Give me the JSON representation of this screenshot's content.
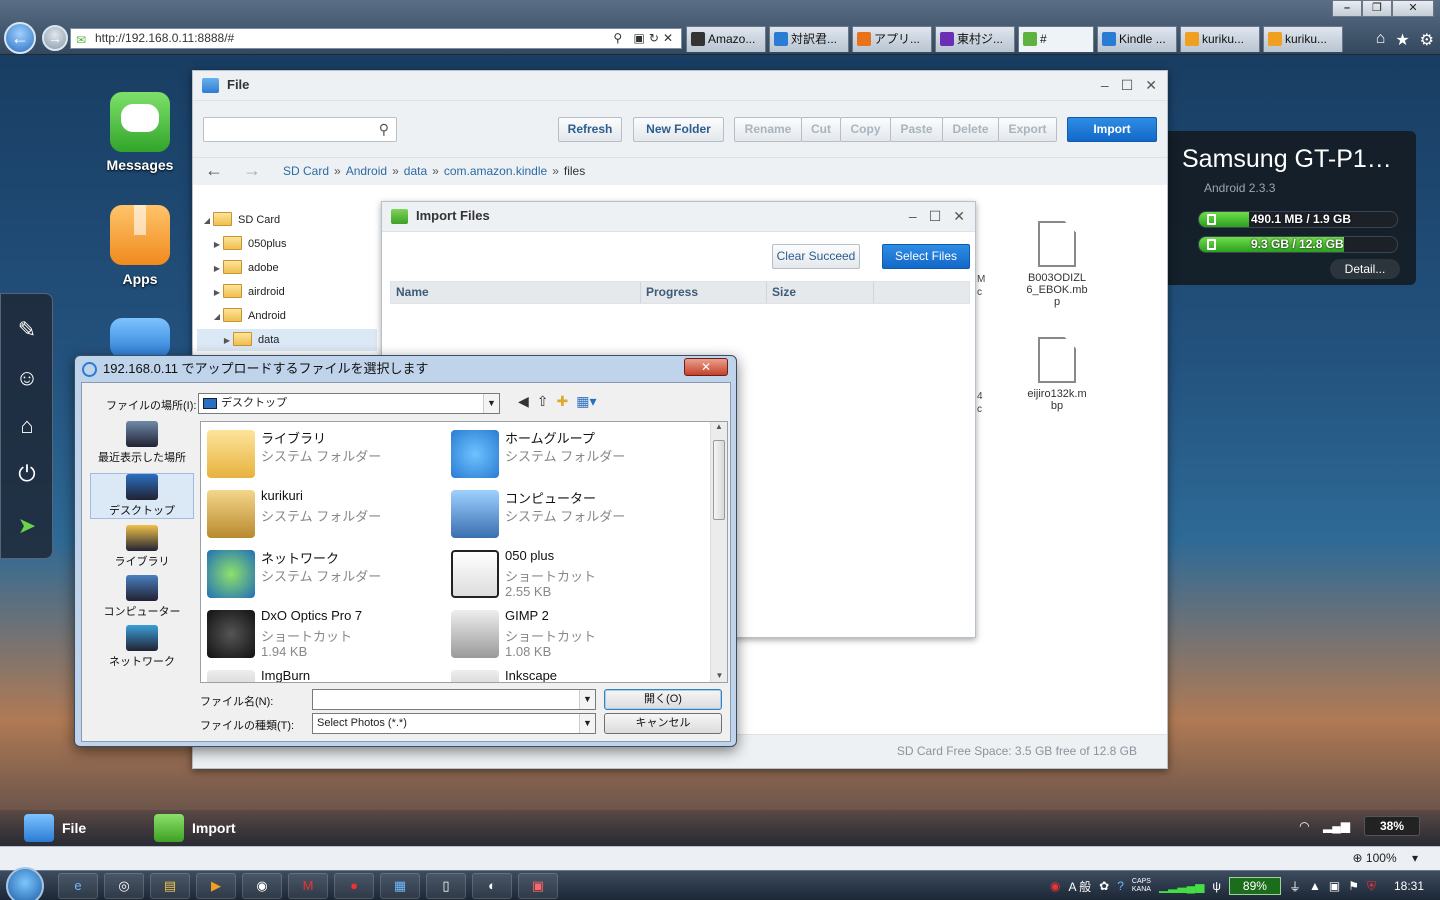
{
  "browser": {
    "url": "http://192.168.0.11:8888/#",
    "tabs": [
      {
        "label": "Amazo...",
        "color": "#333333"
      },
      {
        "label": "対訳君...",
        "color": "#2a7bd3"
      },
      {
        "label": "アプリ...",
        "color": "#e8731b"
      },
      {
        "label": "東村ジ...",
        "color": "#6b2fb6"
      },
      {
        "label": "#",
        "color": "#5db33d"
      },
      {
        "label": "Kindle ...",
        "color": "#2a7bd3"
      },
      {
        "label": "kuriku...",
        "color": "#f0a020"
      },
      {
        "label": "kuriku...",
        "color": "#f0a020"
      }
    ]
  },
  "dock": {
    "messages_label": "Messages",
    "apps_label": "Apps"
  },
  "file_window": {
    "title": "File",
    "search_placeholder": "",
    "buttons": {
      "refresh": "Refresh",
      "new_folder": "New Folder",
      "rename": "Rename",
      "cut": "Cut",
      "copy": "Copy",
      "paste": "Paste",
      "delete": "Delete",
      "export": "Export",
      "import": "Import"
    },
    "breadcrumb": [
      "SD Card",
      "Android",
      "data",
      "com.amazon.kindle",
      "files"
    ],
    "breadcrumb_sep": "»",
    "tree": [
      {
        "label": "SD Card"
      },
      {
        "label": "050plus"
      },
      {
        "label": "adobe"
      },
      {
        "label": "airdroid"
      },
      {
        "label": "Android"
      },
      {
        "label": "data"
      }
    ],
    "files": [
      {
        "name": "B003ODIZL6_EBOK.mbp"
      },
      {
        "name": "eijiro132k.mbp"
      }
    ],
    "partial_labels": [
      "M",
      "c",
      "4",
      "c"
    ],
    "free_space": "SD Card Free Space: 3.5 GB free of 12.8 GB"
  },
  "import_window": {
    "title": "Import Files",
    "clear_btn": "Clear Succeed",
    "select_btn": "Select Files",
    "columns": [
      "Name",
      "Progress",
      "Size"
    ]
  },
  "device": {
    "name": "Samsung GT-P1…",
    "android": "Android 2.3.3",
    "storage": [
      {
        "text": "490.1 MB / 1.9 GB",
        "fraction": 0.25
      },
      {
        "text": "9.3 GB / 12.8 GB",
        "fraction": 0.73
      }
    ],
    "detail_btn": "Detail..."
  },
  "dialog": {
    "title": "192.168.0.11 でアップロードするファイルを選択します",
    "close_label": "✕",
    "location_label": "ファイルの場所(I):",
    "location_value": "デスクトップ",
    "places": [
      {
        "label": "最近表示した場所"
      },
      {
        "label": "デスクトップ"
      },
      {
        "label": "ライブラリ"
      },
      {
        "label": "コンピューター"
      },
      {
        "label": "ネットワーク"
      }
    ],
    "items": [
      {
        "name": "ライブラリ",
        "type": "システム フォルダー",
        "size": ""
      },
      {
        "name": "ホームグループ",
        "type": "システム フォルダー",
        "size": ""
      },
      {
        "name": "kurikuri",
        "type": "システム フォルダー",
        "size": ""
      },
      {
        "name": "コンピューター",
        "type": "システム フォルダー",
        "size": ""
      },
      {
        "name": "ネットワーク",
        "type": "システム フォルダー",
        "size": ""
      },
      {
        "name": "050 plus",
        "type": "ショートカット",
        "size": "2.55 KB"
      },
      {
        "name": "DxO Optics Pro 7",
        "type": "ショートカット",
        "size": "1.94 KB"
      },
      {
        "name": "GIMP 2",
        "type": "ショートカット",
        "size": "1.08 KB"
      },
      {
        "name": "ImgBurn",
        "type": "",
        "size": ""
      },
      {
        "name": "Inkscape",
        "type": "",
        "size": ""
      }
    ],
    "filename_label": "ファイル名(N):",
    "filename_value": "",
    "filetype_label": "ファイルの種類(T):",
    "filetype_value": "Select Photos (*.*)",
    "open_btn": "開く(O)",
    "cancel_btn": "キャンセル"
  },
  "app_taskbar": {
    "file": "File",
    "import": "Import",
    "battery": "38%"
  },
  "ie_status": {
    "zoom": "100%"
  },
  "win_taskbar": {
    "ime": "A 般",
    "caps": "CAPS",
    "kana": "KANA",
    "battery": "89%",
    "time": "18:31"
  }
}
